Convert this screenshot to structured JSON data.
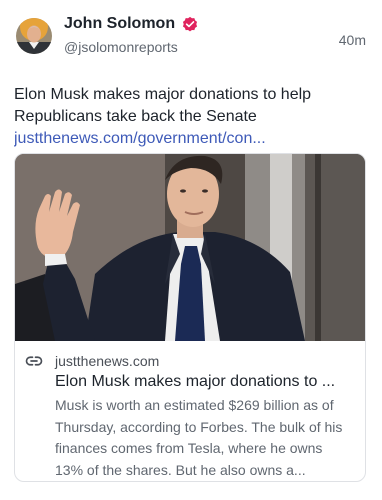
{
  "author": {
    "display_name": "John Solomon",
    "handle": "@jsolomonreports",
    "verified_icon": "verified-badge-icon",
    "avatar_icon": "avatar"
  },
  "timestamp": "40m",
  "post": {
    "text": "Elon Musk makes major donations to help Republicans take back the Senate",
    "link_text": "justthenews.com/government/con..."
  },
  "card": {
    "domain": "justthenews.com",
    "title": "Elon Musk makes major donations to ...",
    "description": "Musk is worth an estimated $269 billion as of Thursday, according to Forbes. The bulk of his finances comes from Tesla, where he owns 13% of the shares. But he also owns a...",
    "link_icon": "link-icon"
  },
  "colors": {
    "link": "#3e5ab8",
    "badge": "#e0245e",
    "text": "#1d232b",
    "muted": "#606770"
  }
}
